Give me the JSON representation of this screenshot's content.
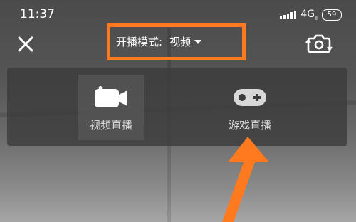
{
  "status_bar": {
    "time": "11:37",
    "network": "4G",
    "network_sub": "ll",
    "battery": "59"
  },
  "header": {
    "mode_label": "开播模式:",
    "mode_value": "视频"
  },
  "mode_panel": {
    "options": [
      {
        "label": "视频直播",
        "icon": "video-camera-icon",
        "selected": true
      },
      {
        "label": "游戏直播",
        "icon": "gamepad-icon",
        "selected": false
      }
    ]
  },
  "colors": {
    "highlight": "#ff7a1f",
    "panel": "#3c3c3c",
    "text_muted": "#d8d8d8"
  }
}
